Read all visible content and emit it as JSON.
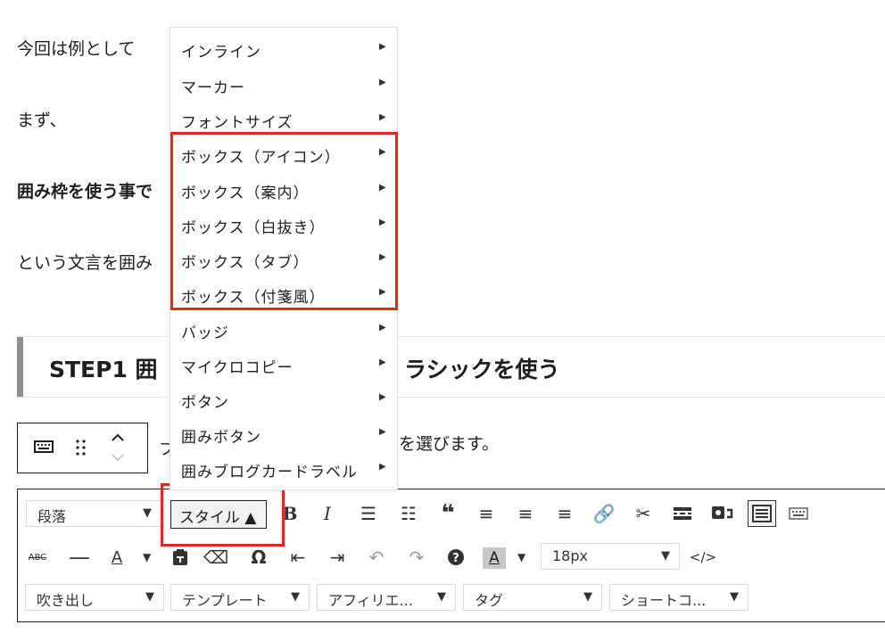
{
  "paragraphs": {
    "p1": "今回は例として",
    "p2": "まず、",
    "p3": "囲み枠を使う事で",
    "p4": "という文言を囲み"
  },
  "heading": {
    "left": "STEP1 囲",
    "right": "ラシックを使う"
  },
  "block_toolbar": {
    "text_fragment": "フ",
    "text_after": "を選びます。"
  },
  "editor_toolbar": {
    "format_select": "段落",
    "style_button": "スタイル ▲",
    "font_size": "18px",
    "row3_selects": [
      "吹き出し",
      "テンプレート",
      "アフィリエ...",
      "タグ",
      "ショートコ..."
    ]
  },
  "style_menu": {
    "items": [
      "インライン",
      "マーカー",
      "フォントサイズ",
      "ボックス（アイコン）",
      "ボックス（案内）",
      "ボックス（白抜き）",
      "ボックス（タブ）",
      "ボックス（付箋風）",
      "バッジ",
      "マイクロコピー",
      "ボタン",
      "囲みボタン",
      "囲みブログカードラベル"
    ]
  },
  "icons": {
    "row1": [
      "bold-icon",
      "italic-icon",
      "bullet-list-icon",
      "numbered-list-icon",
      "blockquote-icon",
      "align-left-icon",
      "align-center-icon",
      "align-right-icon",
      "link-icon",
      "unlink-icon",
      "read-more-icon",
      "image-icon",
      "toolbar-toggle-icon",
      "keyboard-icon"
    ],
    "row2": [
      "strikethrough-icon",
      "horizontal-line-icon",
      "text-color-icon",
      "paste-text-icon",
      "clear-format-icon",
      "special-char-icon",
      "outdent-icon",
      "indent-icon",
      "undo-icon",
      "redo-icon",
      "help-icon",
      "background-color-icon",
      "code-icon"
    ]
  },
  "colors": {
    "highlight": "#e02a1d",
    "heading_bar": "#8f8f8f"
  }
}
